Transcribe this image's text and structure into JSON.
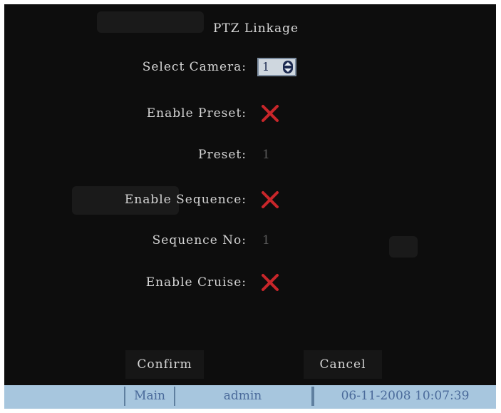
{
  "screen": {
    "title": "PTZ Linkage"
  },
  "form": {
    "select_camera": {
      "label": "Select Camera:",
      "value": "1"
    },
    "enable_preset": {
      "label": "Enable Preset:",
      "checked": false
    },
    "preset": {
      "label": "Preset:",
      "value": "1"
    },
    "enable_sequence": {
      "label": "Enable Sequence:",
      "checked": false
    },
    "sequence_no": {
      "label": "Sequence No:",
      "value": "1"
    },
    "enable_cruise": {
      "label": "Enable Cruise:",
      "checked": false
    }
  },
  "buttons": {
    "confirm": "Confirm",
    "cancel": "Cancel"
  },
  "status_bar": {
    "menu": "Main",
    "user": "admin",
    "datetime": "06-11-2008 10:07:39"
  },
  "colors": {
    "background": "#0d0d0d",
    "label": "#d6d6d6",
    "cross_mark": "#c8262a",
    "status_bar": "#a7c6de",
    "status_text": "#4a6a9a"
  },
  "icons": {
    "unchecked": "red-x-icon",
    "spinner": "up-down-spinner-icon"
  }
}
